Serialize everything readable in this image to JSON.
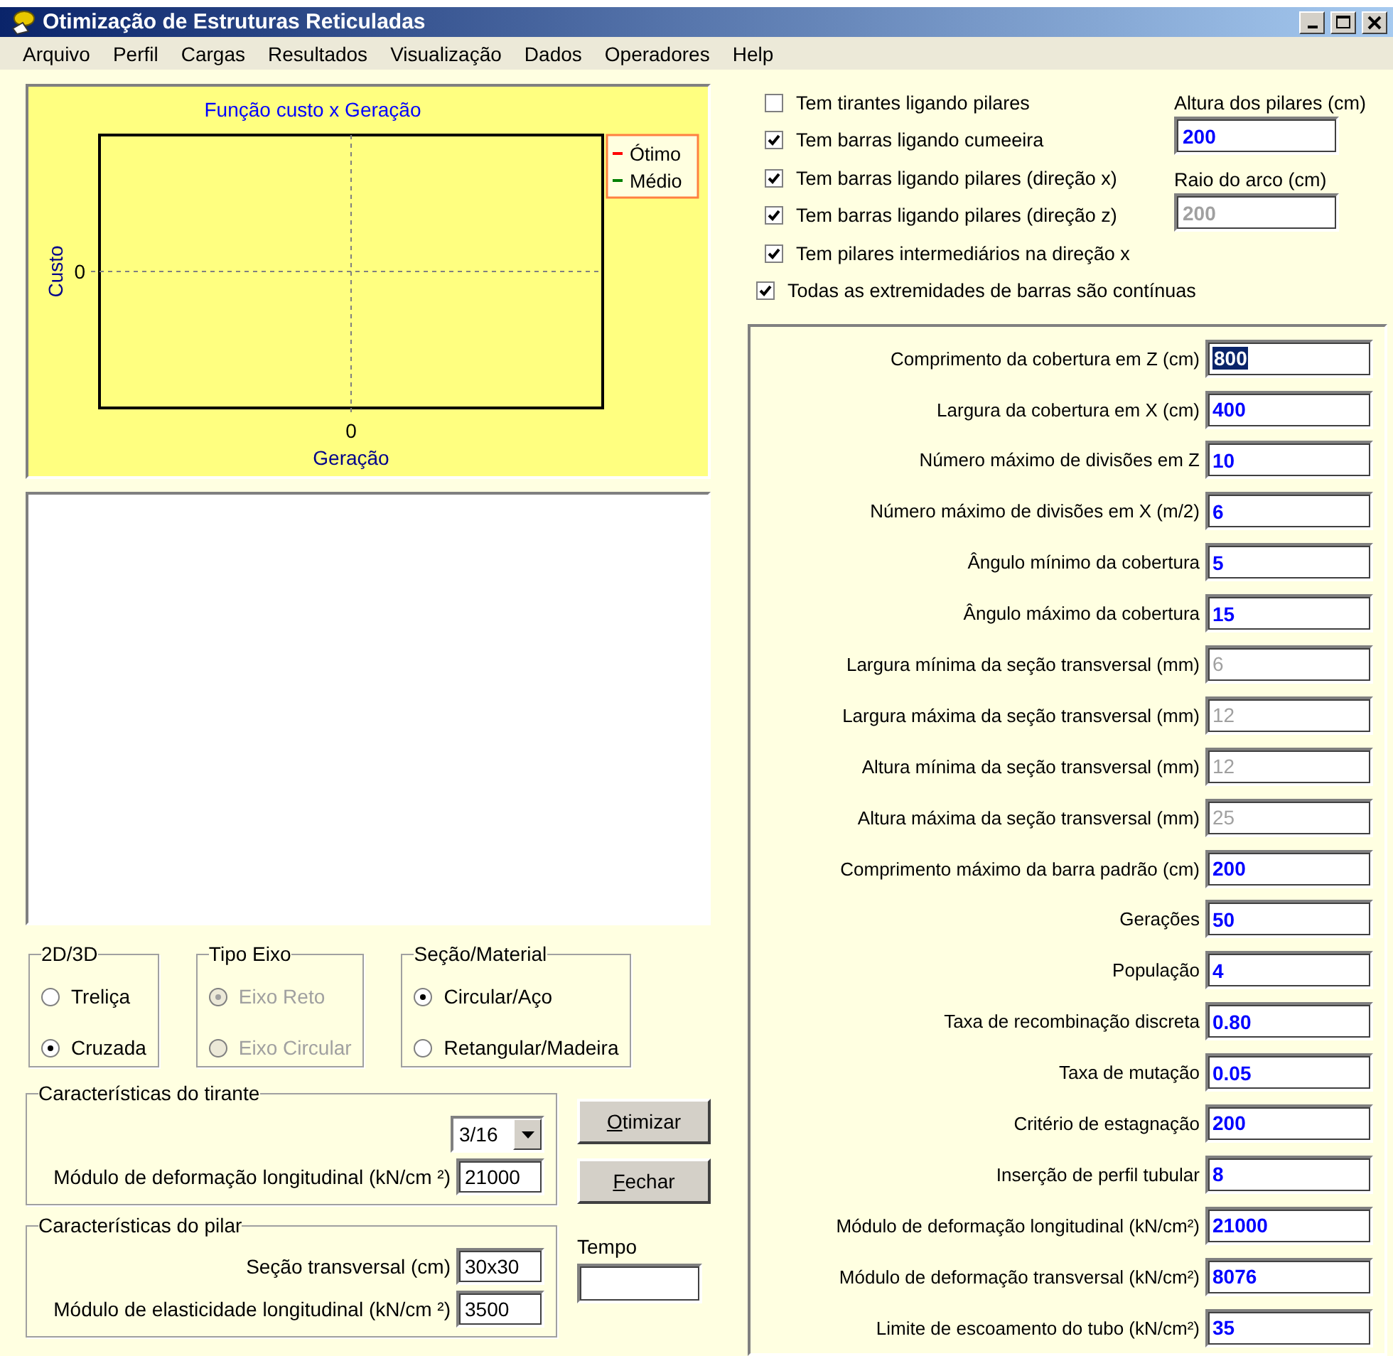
{
  "window": {
    "title": "Otimização de Estruturas Reticuladas"
  },
  "menu": [
    "Arquivo",
    "Perfil",
    "Cargas",
    "Resultados",
    "Visualização",
    "Dados",
    "Operadores",
    "Help"
  ],
  "chart": {
    "title": "Função custo x Geração",
    "xlabel": "Geração",
    "ylabel": "Custo",
    "x_tick": "0",
    "y_tick": "0",
    "legend": [
      {
        "name": "Ótimo",
        "color": "#ff0000"
      },
      {
        "name": "Médio",
        "color": "#008000"
      }
    ]
  },
  "radio_groups": [
    {
      "title": "2D/3D",
      "disabled": false,
      "options": [
        {
          "label": "Treliça",
          "selected": false
        },
        {
          "label": "Cruzada",
          "selected": true
        }
      ]
    },
    {
      "title": "Tipo Eixo",
      "disabled": true,
      "options": [
        {
          "label": "Eixo Reto",
          "selected": true
        },
        {
          "label": "Eixo Circular",
          "selected": false
        }
      ]
    },
    {
      "title": "Seção/Material",
      "disabled": false,
      "options": [
        {
          "label": "Circular/Aço",
          "selected": true
        },
        {
          "label": "Retangular/Madeira",
          "selected": false
        }
      ]
    }
  ],
  "tirante": {
    "title": "Características do tirante",
    "dropdown": "3/16",
    "field_label": "Módulo de deformação longitudinal (kN/cm ²)",
    "field_value": "21000"
  },
  "pilar": {
    "title": "Características do pilar",
    "fields": [
      {
        "label": "Seção transversal (cm)",
        "value": "30x30"
      },
      {
        "label": "Módulo de elasticidade longitudinal (kN/cm ²)",
        "value": "3500"
      }
    ]
  },
  "buttons": [
    "Otimizar",
    "Fechar"
  ],
  "tempo": {
    "label": "Tempo"
  },
  "checkboxes": [
    {
      "label": "Tem tirantes ligando pilares",
      "checked": false
    },
    {
      "label": "Tem barras ligando cumeeira",
      "checked": true
    },
    {
      "label": "Tem barras ligando pilares (direção x)",
      "checked": true
    },
    {
      "label": "Tem barras ligando pilares (direção z)",
      "checked": true
    },
    {
      "label": "Tem pilares intermediários na direção x",
      "checked": true
    },
    {
      "label": "Todas as extremidades de barras são contínuas",
      "checked": true
    }
  ],
  "side_fields": [
    {
      "label": "Altura dos pilares (cm)",
      "value": "200",
      "disabled": false
    },
    {
      "label": "Raio do arco (cm)",
      "value": "200",
      "disabled": true
    }
  ],
  "parameters": [
    {
      "label": "Comprimento  da cobertura em Z (cm)",
      "value": "800",
      "disabled": false,
      "selected": true
    },
    {
      "label": "Largura da cobertura em X (cm)",
      "value": "400",
      "disabled": false,
      "selected": false
    },
    {
      "label": "Número máximo de divisões em Z",
      "value": "10",
      "disabled": false,
      "selected": false
    },
    {
      "label": "Número máximo de divisões em X (m/2)",
      "value": "6",
      "disabled": false,
      "selected": false
    },
    {
      "label": "Ângulo mínimo da cobertura",
      "value": "5",
      "disabled": false,
      "selected": false
    },
    {
      "label": "Ângulo máximo da cobertura",
      "value": "15",
      "disabled": false,
      "selected": false
    },
    {
      "label": "Largura mínima da seção transversal (mm)",
      "value": "6",
      "disabled": true,
      "selected": false
    },
    {
      "label": "Largura máxima da seção transversal (mm)",
      "value": "12",
      "disabled": true,
      "selected": false
    },
    {
      "label": "Altura mínima da seção transversal (mm)",
      "value": "12",
      "disabled": true,
      "selected": false
    },
    {
      "label": "Altura máxima da seção transversal (mm)",
      "value": "25",
      "disabled": true,
      "selected": false
    },
    {
      "label": "Comprimento máximo da barra padrão (cm)",
      "value": "200",
      "disabled": false,
      "selected": false
    },
    {
      "label": "Gerações",
      "value": "50",
      "disabled": false,
      "selected": false
    },
    {
      "label": "População",
      "value": "4",
      "disabled": false,
      "selected": false
    },
    {
      "label": "Taxa de recombinação discreta",
      "value": "0.80",
      "disabled": false,
      "selected": false
    },
    {
      "label": "Taxa de mutação",
      "value": "0.05",
      "disabled": false,
      "selected": false
    },
    {
      "label": "Critério de estagnação",
      "value": "200",
      "disabled": false,
      "selected": false
    },
    {
      "label": "Inserção de perfil tubular",
      "value": "8",
      "disabled": false,
      "selected": false
    },
    {
      "label": "Módulo de deformação longitudinal (kN/cm²)",
      "value": "21000",
      "disabled": false,
      "selected": false
    },
    {
      "label": "Módulo de deformação transversal (kN/cm²)",
      "value": "8076",
      "disabled": false,
      "selected": false
    },
    {
      "label": "Limite de escoamento do tubo (kN/cm²)",
      "value": "35",
      "disabled": false,
      "selected": false
    }
  ]
}
